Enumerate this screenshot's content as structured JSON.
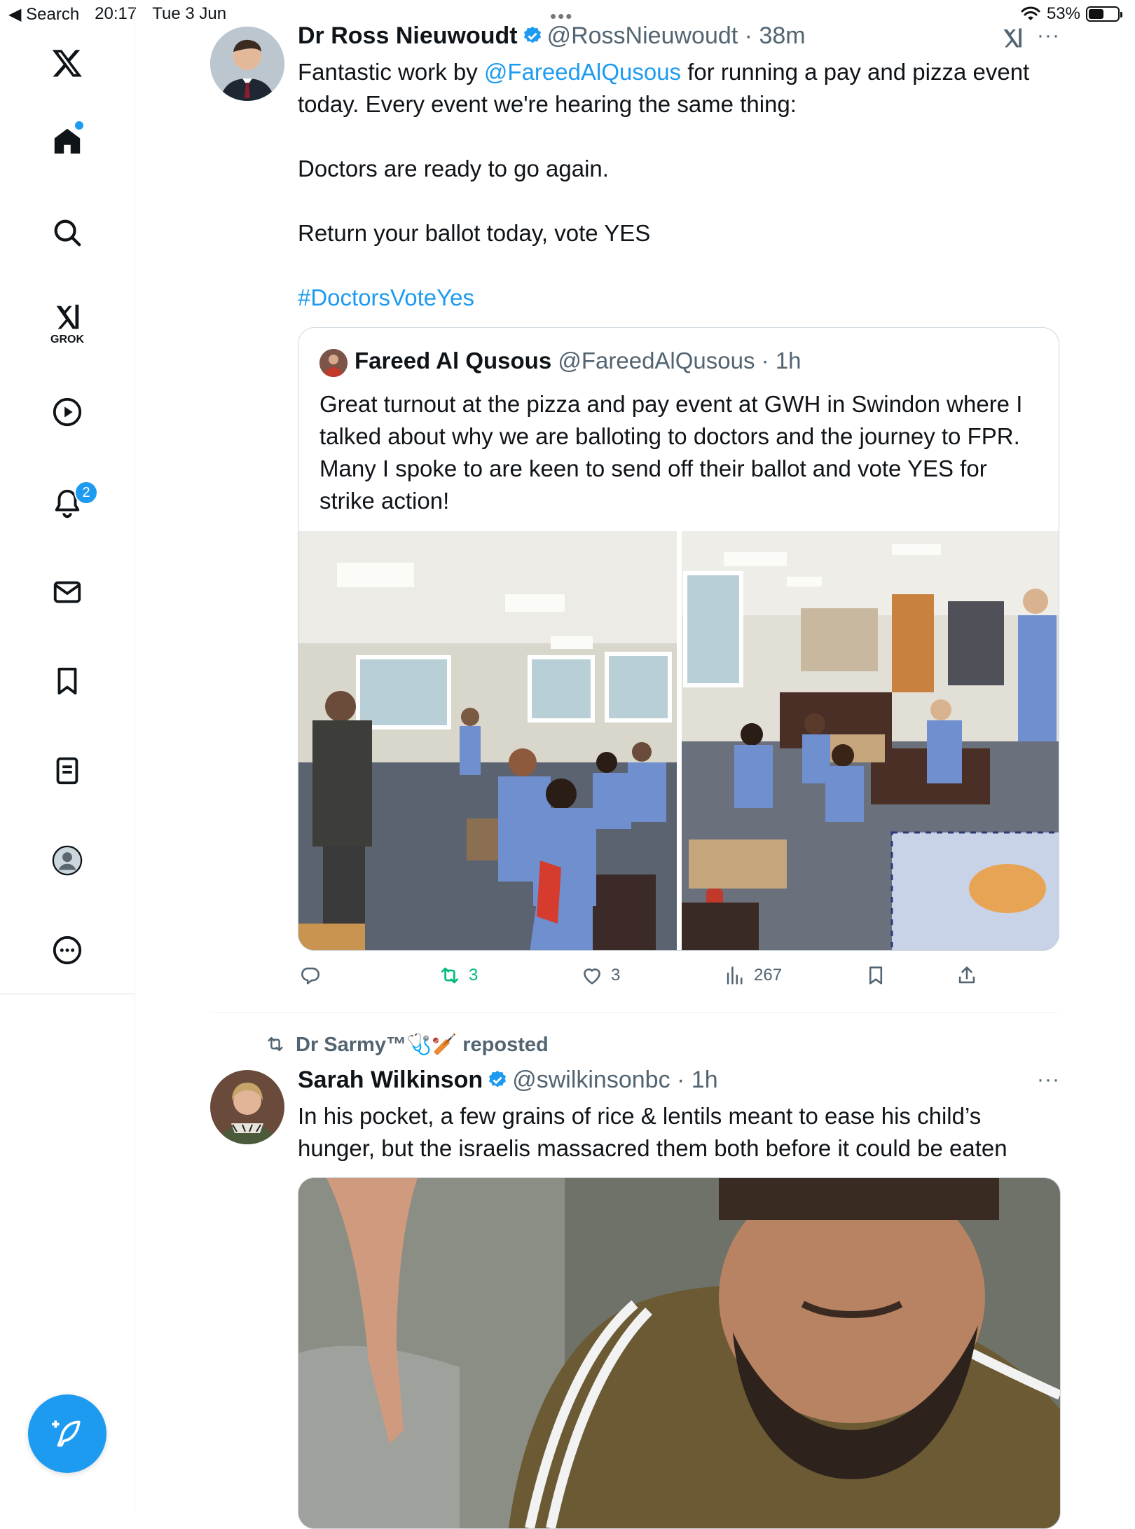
{
  "status_bar": {
    "back_label": "◀ Search",
    "time": "20:17",
    "date": "Tue 3 Jun",
    "battery": "53%",
    "battery_level": 0.53
  },
  "sidebar": {
    "grok_label": "GROK",
    "notifications_badge": "2"
  },
  "tweet1": {
    "name": "Dr Ross Nieuwoudt",
    "handle": "@RossNieuwoudt",
    "time": "38m",
    "text_before_mention": "Fantastic work by ",
    "mention": "@FareedAlQusous",
    "text_after_mention": " for running a pay and pizza event today. Every event we're hearing the same thing:",
    "line2": "Doctors are ready to go again.",
    "line3": "Return your ballot today, vote YES",
    "hashtag": "#DoctorsVoteYes",
    "quote": {
      "name": "Fareed Al Qusous",
      "handle": "@FareedAlQusous",
      "time": "1h",
      "text": "Great turnout at the pizza and pay event at GWH in Swindon where I talked about why we are balloting to doctors and the journey to FPR. Many I spoke to are keen to send off their ballot and vote YES for strike action!"
    },
    "stats": {
      "retweets": "3",
      "likes": "3",
      "views": "267"
    }
  },
  "tweet2": {
    "reposted_by": "Dr Sarmy™🩺🏏 reposted",
    "name": "Sarah Wilkinson",
    "handle": "@swilkinsonbc",
    "time": "1h",
    "text": "In his pocket, a few grains of rice & lentils meant to ease his child’s hunger, but the israelis massacred them both before it could be eaten"
  },
  "colors": {
    "accent": "#1d9bf0",
    "text": "#0f1419",
    "secondary": "#536471",
    "retweet_green": "#00ba7c"
  }
}
